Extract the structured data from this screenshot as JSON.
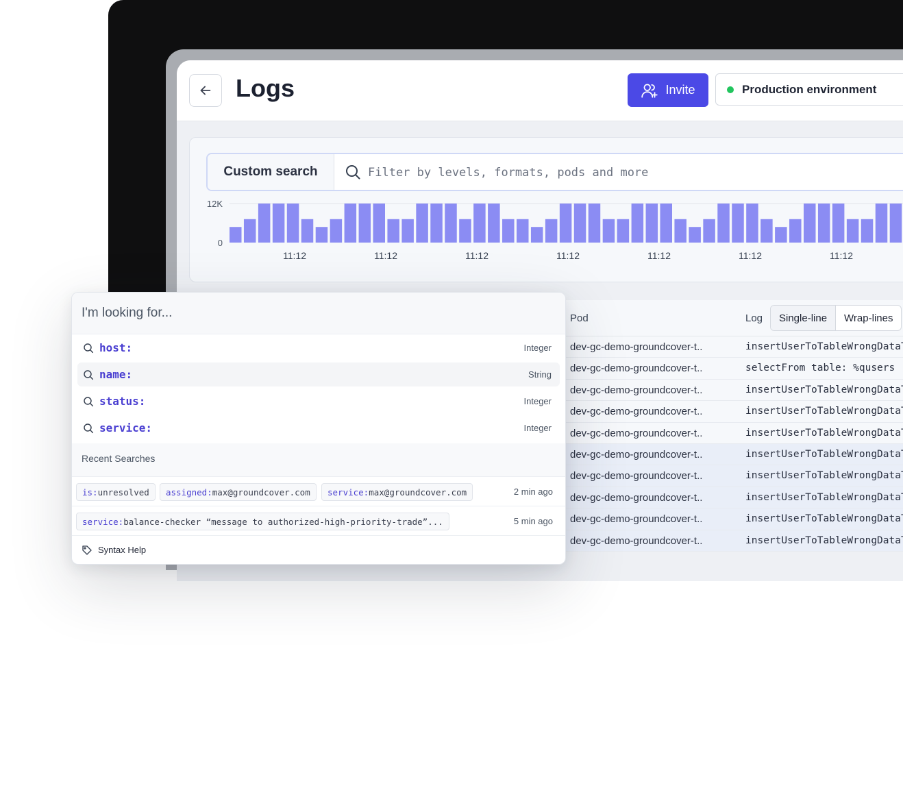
{
  "header": {
    "title": "Logs",
    "invite_label": "Invite",
    "environment_label": "Production environment",
    "environment_status_color": "#22c55e"
  },
  "search": {
    "mode_label": "Custom search",
    "placeholder": "Filter by levels, formats, pods and more"
  },
  "chart_data": {
    "type": "bar",
    "y_tick_labels": [
      "12K",
      "0"
    ],
    "ylim": [
      0,
      12000
    ],
    "x_tick_labels": [
      "11:12",
      "11:12",
      "11:12",
      "11:12",
      "11:12",
      "11:12",
      "11:12"
    ],
    "values": [
      4800,
      7200,
      12000,
      12000,
      12000,
      7200,
      4800,
      7200,
      12000,
      12000,
      12000,
      7200,
      7200,
      12000,
      12000,
      12000,
      7200,
      12000,
      12000,
      7200,
      7200,
      4800,
      7200,
      12000,
      12000,
      12000,
      7200,
      7200,
      12000,
      12000,
      12000,
      7200,
      4800,
      7200,
      12000,
      12000,
      12000,
      7200,
      4800,
      7200,
      12000,
      12000,
      12000,
      7200,
      7200,
      12000,
      12000
    ],
    "bar_color": "#8b8cf3"
  },
  "table": {
    "col_pod": "Pod",
    "col_log": "Log",
    "toggle_single": "Single-line",
    "toggle_wrap": "Wrap-lines",
    "rows": [
      {
        "pod": "dev-gc-demo-groundcover-t..",
        "log": "insertUserToTableWrongDataT"
      },
      {
        "pod": "dev-gc-demo-groundcover-t..",
        "log": "selectFrom table: %qusers"
      },
      {
        "pod": "dev-gc-demo-groundcover-t..",
        "log": "insertUserToTableWrongDataT"
      },
      {
        "pod": "dev-gc-demo-groundcover-t..",
        "log": "insertUserToTableWrongDataT"
      },
      {
        "pod": "dev-gc-demo-groundcover-t..",
        "log": "insertUserToTableWrongDataT"
      },
      {
        "pod": "dev-gc-demo-groundcover-t..",
        "log": "insertUserToTableWrongDataT"
      },
      {
        "pod": "dev-gc-demo-groundcover-t..",
        "log": "insertUserToTableWrongDataT"
      },
      {
        "pod": "dev-gc-demo-groundcover-t..",
        "log": "insertUserToTableWrongDataT"
      },
      {
        "pod": "dev-gc-demo-groundcover-t..",
        "log": "insertUserToTableWrongDataT"
      },
      {
        "pod": "dev-gc-demo-groundcover-t..",
        "log": "insertUserToTableWrongDataT"
      }
    ]
  },
  "popup": {
    "placeholder": "I'm looking for...",
    "suggestions": [
      {
        "key": "host:",
        "type": "Integer"
      },
      {
        "key": "name:",
        "type": "String"
      },
      {
        "key": "status:",
        "type": "Integer"
      },
      {
        "key": "service:",
        "type": "Integer"
      }
    ],
    "recent_title": "Recent Searches",
    "recent": [
      {
        "chips": [
          {
            "k": "is:",
            "v": "unresolved"
          },
          {
            "k": "assigned:",
            "v": "max@groundcover.com"
          },
          {
            "k": "service:",
            "v": "max@groundcover.com"
          }
        ],
        "ago": "2 min ago"
      },
      {
        "chips": [
          {
            "k": "service:",
            "v": "balance-checker “message to authorized-high-priority-trade”..."
          }
        ],
        "ago": "5 min ago"
      }
    ],
    "syntax_help": "Syntax Help"
  }
}
